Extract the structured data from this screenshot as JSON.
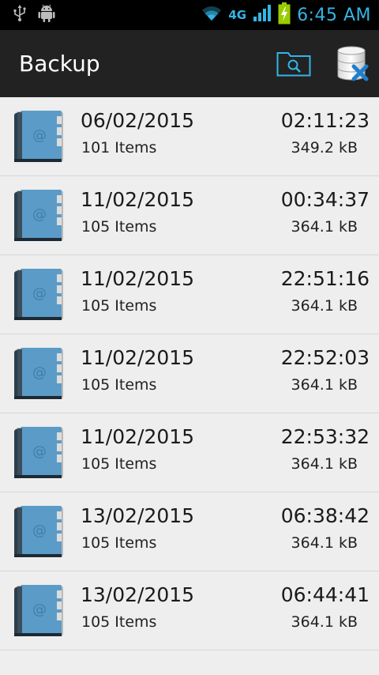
{
  "status_bar": {
    "network": "4G",
    "time": "6:45 AM",
    "icons": [
      "usb-icon",
      "android-debug-icon",
      "wifi-icon",
      "signal-icon",
      "battery-charging-icon"
    ]
  },
  "action_bar": {
    "title": "Backup",
    "actions": [
      "search-backup-icon",
      "clear-database-icon"
    ]
  },
  "backups": [
    {
      "date": "06/02/2015",
      "items": "101 Items",
      "time": "02:11:23",
      "size": "349.2 kB"
    },
    {
      "date": "11/02/2015",
      "items": "105 Items",
      "time": "00:34:37",
      "size": "364.1 kB"
    },
    {
      "date": "11/02/2015",
      "items": "105 Items",
      "time": "22:51:16",
      "size": "364.1 kB"
    },
    {
      "date": "11/02/2015",
      "items": "105 Items",
      "time": "22:52:03",
      "size": "364.1 kB"
    },
    {
      "date": "11/02/2015",
      "items": "105 Items",
      "time": "22:53:32",
      "size": "364.1 kB"
    },
    {
      "date": "13/02/2015",
      "items": "105 Items",
      "time": "06:38:42",
      "size": "364.1 kB"
    },
    {
      "date": "13/02/2015",
      "items": "105 Items",
      "time": "06:44:41",
      "size": "364.1 kB"
    }
  ],
  "colors": {
    "accent": "#33b5e5",
    "action_bar": "#222222",
    "background": "#eeeeee",
    "book_cover": "#5b9bc7"
  }
}
